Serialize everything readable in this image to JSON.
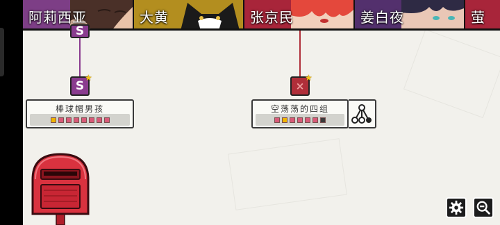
{
  "tabs": [
    {
      "name": "阿莉西亚",
      "color": "#7d3e86"
    },
    {
      "name": "大黄",
      "color": "#b38e1f"
    },
    {
      "name": "张京民",
      "color": "#a8253a"
    },
    {
      "name": "姜白夜",
      "color": "#53306d"
    },
    {
      "name": "萤",
      "color": "#a8253a"
    }
  ],
  "nodes": [
    {
      "label": "S",
      "color": "#8a3c8f"
    },
    {
      "label": "S",
      "color": "#8a3c8f"
    },
    {
      "label": "×",
      "color": "#b02e39"
    }
  ],
  "cards": [
    {
      "title": "棒球帽男孩",
      "pips": [
        "#f0b400",
        "#d85a78",
        "#d85a78",
        "#d85a78",
        "#d85a78",
        "#d85a78",
        "#d85a78",
        "#d85a78"
      ]
    },
    {
      "title": "空荡荡的四组",
      "pips": [
        "#d85a78",
        "#f0b400",
        "#d85a78",
        "#d85a78",
        "#d85a78",
        "#d85a78",
        "#3a3a3a"
      ]
    }
  ],
  "icons": {
    "settings": "gear-icon",
    "zoom": "zoom-out-icon",
    "branch": "branch-icon",
    "mailbox": "mailbox-icon"
  }
}
